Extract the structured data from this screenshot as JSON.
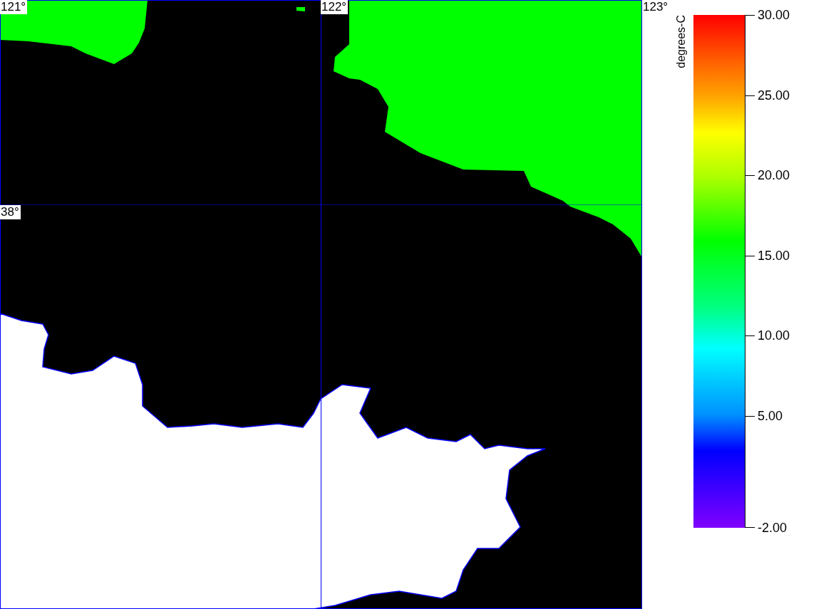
{
  "map": {
    "longitude_labels": [
      "121°",
      "122°",
      "123°"
    ],
    "latitude_labels": [
      "38°"
    ]
  },
  "color_scale": {
    "unit": "degrees-C",
    "ticks": [
      "30.00",
      "25.00",
      "20.00",
      "15.00",
      "10.00",
      "5.00",
      "-2.00"
    ]
  }
}
